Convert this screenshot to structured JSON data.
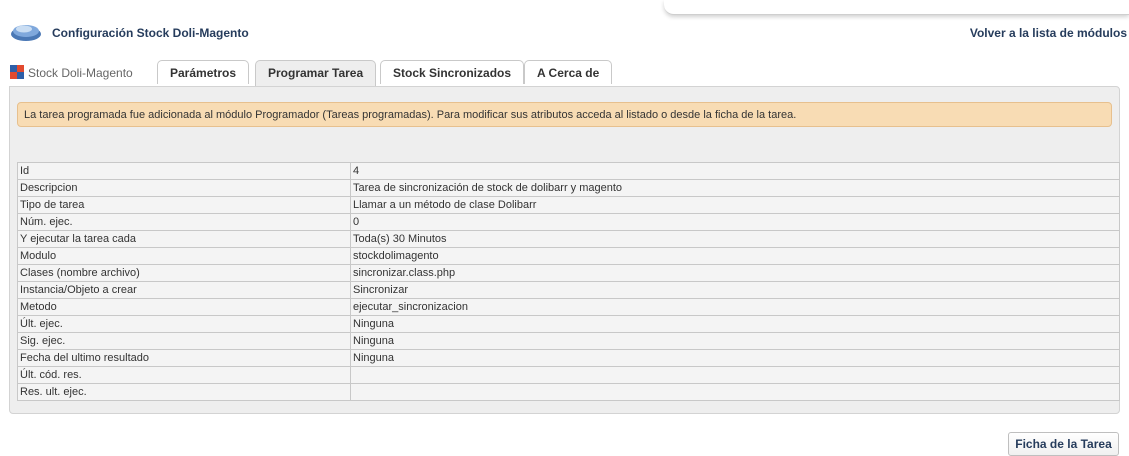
{
  "header": {
    "title": "Configuración Stock Doli-Magento",
    "back_link": "Volver a la lista de módulos"
  },
  "tabs": {
    "current": "Stock Doli-Magento",
    "items": [
      {
        "label": "Parámetros"
      },
      {
        "label": "Programar Tarea"
      },
      {
        "label": "Stock Sincronizados"
      },
      {
        "label": "A Cerca de"
      }
    ],
    "active": "Programar Tarea"
  },
  "notice": {
    "before": "La tarea programada fue adicionada al módulo Programador (Tareas programadas). Para modificar sus atributos acceda al ",
    "link": "listado",
    "after": " o desde la ficha de la tarea."
  },
  "task": {
    "rows": [
      {
        "label": "Id",
        "value": "4"
      },
      {
        "label": "Descripcion",
        "value": "Tarea de sincronización de stock de dolibarr y magento"
      },
      {
        "label": "Tipo de tarea",
        "value": "Llamar a un método de clase Dolibarr"
      },
      {
        "label": "Núm. ejec.",
        "value": "0"
      },
      {
        "label": "Y ejecutar la tarea cada",
        "value": "Toda(s) 30 Minutos"
      },
      {
        "label": "Modulo",
        "value": "stockdolimagento"
      },
      {
        "label": "Clases (nombre archivo)",
        "value": "sincronizar.class.php"
      },
      {
        "label": "Instancia/Objeto a crear",
        "value": "Sincronizar"
      },
      {
        "label": "Metodo",
        "value": "ejecutar_sincronizacion"
      },
      {
        "label": "Últ. ejec.",
        "value": "Ninguna"
      },
      {
        "label": "Sig. ejec.",
        "value": "Ninguna"
      },
      {
        "label": "Fecha del ultimo resultado",
        "value": "Ninguna"
      },
      {
        "label": "Últ. cód. res.",
        "value": ""
      },
      {
        "label": "Res. ult. ejec.",
        "value": ""
      }
    ]
  },
  "actions": {
    "task_card_button": "Ficha de la Tarea"
  }
}
